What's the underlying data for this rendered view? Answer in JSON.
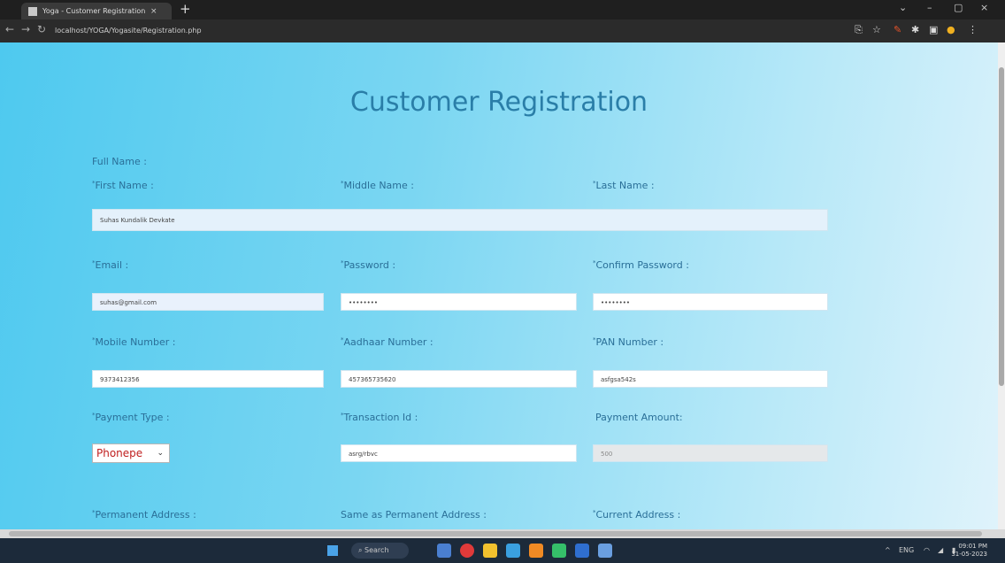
{
  "browser": {
    "tab_title": "Yoga - Customer Registration",
    "tab_close": "×",
    "new_tab": "+",
    "url": "localhost/YOGA/Yogasite/Registration.php",
    "win_minimize": "–",
    "win_restore": "▢",
    "win_close": "×"
  },
  "page": {
    "title": "Customer Registration",
    "full_name_label": "Full Name :",
    "first_name_label": "First Name :",
    "middle_name_label": "Middle Name :",
    "last_name_label": "Last Name :",
    "full_name_value": "Suhas Kundalik Devkate",
    "email_label": "Email :",
    "password_label": "Password :",
    "confirm_password_label": "Confirm Password :",
    "email_value": "suhas@gmail.com",
    "password_value": "••••••••",
    "confirm_password_value": "••••••••",
    "mobile_label": "Mobile Number :",
    "aadhaar_label": "Aadhaar Number :",
    "pan_label": "PAN Number :",
    "mobile_value": "9373412356",
    "aadhaar_value": "457365735620",
    "pan_value": "asfgsa542s",
    "payment_type_label": "Payment Type :",
    "transaction_label": "Transaction Id :",
    "payment_amount_label": "Payment Amount:",
    "payment_type_value": "Phonepe",
    "transaction_value": "asrg/rbvc",
    "payment_amount_value": "500",
    "permanent_address_label": "Permanent Address :",
    "same_address_label": "Same as Permanent Address :",
    "current_address_label": "Current Address :"
  },
  "taskbar": {
    "search_text": "Search",
    "lang": "ENG",
    "time": "09:01 PM",
    "date": "31-05-2023"
  }
}
